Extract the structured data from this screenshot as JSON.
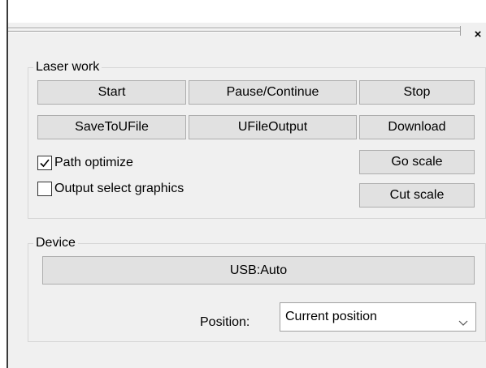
{
  "close_glyph": "×",
  "laser_work": {
    "title": "Laser work",
    "buttons": {
      "start": "Start",
      "pause_continue": "Pause/Continue",
      "stop": "Stop",
      "save_to_ufile": "SaveToUFile",
      "ufile_output": "UFileOutput",
      "download": "Download",
      "go_scale": "Go scale",
      "cut_scale": "Cut scale"
    },
    "checkboxes": {
      "path_optimize": {
        "label": "Path optimize",
        "checked": true
      },
      "output_select_graphics": {
        "label": "Output select graphics",
        "checked": false
      }
    }
  },
  "device": {
    "title": "Device",
    "usb_button": "USB:Auto",
    "position_label": "Position:",
    "position_value": "Current position"
  },
  "icons": [
    "close-icon",
    "checkmark-icon",
    "chevron-down-icon"
  ]
}
